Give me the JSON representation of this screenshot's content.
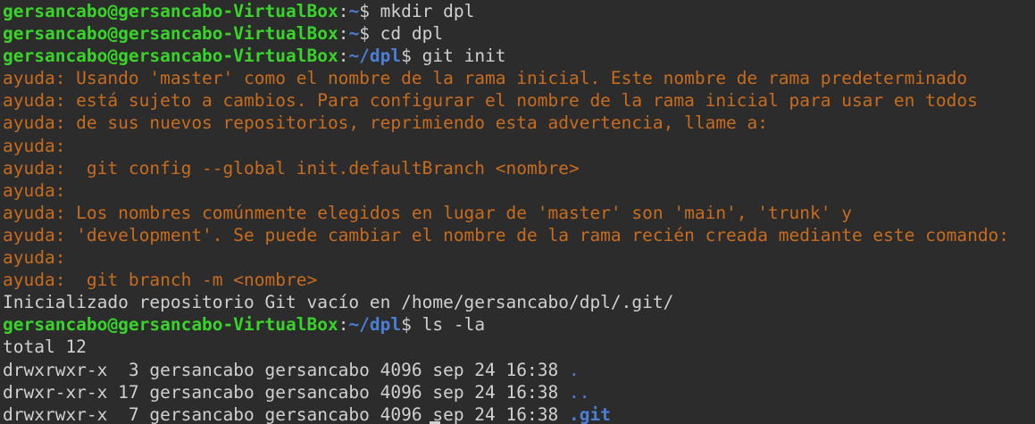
{
  "prompt": {
    "user_host": "gersancabo@gersancabo-VirtualBox",
    "colon": ":",
    "home": "~",
    "home_dpl": "~/dpl",
    "dollar": "$"
  },
  "commands": {
    "mkdir": " mkdir dpl",
    "cd": " cd dpl",
    "git_init": " git init",
    "ls": " ls -la"
  },
  "hints": [
    "ayuda: Usando 'master' como el nombre de la rama inicial. Este nombre de rama predeterminado",
    "ayuda: está sujeto a cambios. Para configurar el nombre de la rama inicial para usar en todos",
    "ayuda: de sus nuevos repositorios, reprimiendo esta advertencia, llame a:",
    "ayuda:",
    "ayuda:  git config --global init.defaultBranch <nombre>",
    "ayuda:",
    "ayuda: Los nombres comúnmente elegidos en lugar de 'master' son 'main', 'trunk' y",
    "ayuda: 'development'. Se puede cambiar el nombre de la rama recién creada mediante este comando:",
    "ayuda:",
    "ayuda:  git branch -m <nombre>"
  ],
  "init_output": "Inicializado repositorio Git vacío en /home/gersancabo/dpl/.git/",
  "total": "total 12",
  "listing": [
    {
      "info": "drwxrwxr-x  3 gersancabo gersancabo 4096 sep 24 16:38 ",
      "name": "."
    },
    {
      "info": "drwxr-xr-x 17 gersancabo gersancabo 4096 sep 24 16:38 ",
      "name": ".."
    },
    {
      "info": "drwxrwxr-x  7 gersancabo gersancabo 4096 sep 24 16:38 ",
      "name": ".git"
    }
  ],
  "colors": {
    "background": "#2c2c2c",
    "prompt_user": "#39d42a",
    "prompt_path": "#4b7fd6",
    "hint_text": "#c76c1e",
    "default_text": "#d0d0d0"
  }
}
